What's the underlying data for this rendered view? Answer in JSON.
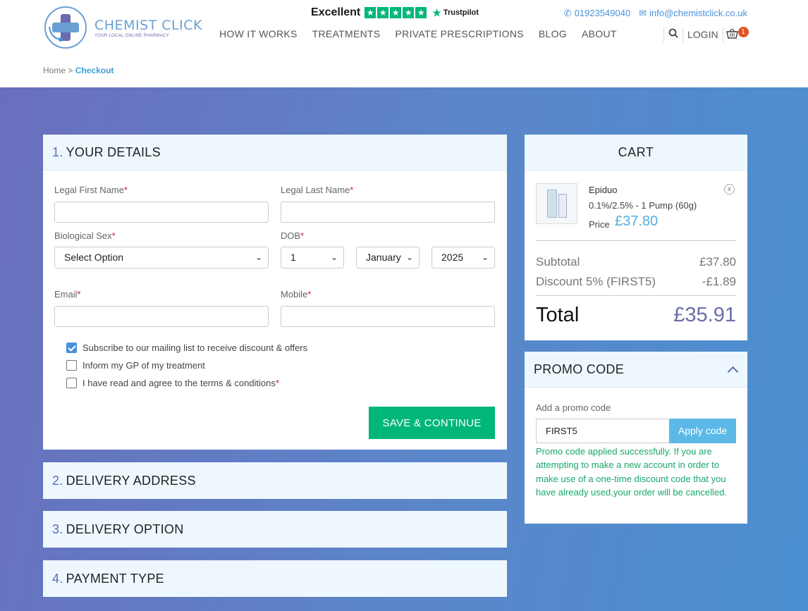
{
  "header": {
    "logo": {
      "name": "CHEMIST CLICK",
      "tagline": "YOUR LOCAL ONLINE PHARMACY"
    },
    "trustpilot": {
      "label": "Excellent",
      "stars": 5,
      "brand": "Trustpilot"
    },
    "contact": {
      "phone": "01923549040",
      "email": "info@chemistclick.co.uk"
    },
    "nav": [
      "HOW IT WORKS",
      "TREATMENTS",
      "PRIVATE PRESCRIPTIONS",
      "BLOG",
      "ABOUT"
    ],
    "login_label": "LOGIN",
    "cart_count": "1"
  },
  "breadcrumb": {
    "home": "Home",
    "sep": ">",
    "current": "Checkout"
  },
  "steps": {
    "details": {
      "num": "1.",
      "title": "YOUR DETAILS",
      "first_name_label": "Legal First Name",
      "last_name_label": "Legal Last Name",
      "sex_label": "Biological Sex",
      "sex_value": "Select Option",
      "dob_label": "DOB",
      "dob_day": "1",
      "dob_month": "January",
      "dob_year": "2025",
      "email_label": "Email",
      "mobile_label": "Mobile",
      "req_mark": "*",
      "check_subscribe": "Subscribe to our mailing list to receive discount & offers",
      "check_gp": "Inform my GP of my treatment",
      "check_terms": "I have read and agree to the terms & conditions",
      "save_label": "SAVE & CONTINUE"
    },
    "delivery_address": {
      "num": "2.",
      "title": "DELIVERY ADDRESS"
    },
    "delivery_option": {
      "num": "3.",
      "title": "DELIVERY OPTION"
    },
    "payment_type": {
      "num": "4.",
      "title": "PAYMENT TYPE"
    }
  },
  "cart": {
    "title": "CART",
    "product_name": "Epiduo",
    "product_variant": "0.1%/2.5% - 1 Pump (60g)",
    "price_label": "Price",
    "price": "£37.80",
    "remove": "x",
    "subtotal_label": "Subtotal",
    "subtotal": "£37.80",
    "discount_label": "Discount 5% (FIRST5)",
    "discount": "-£1.89",
    "total_label": "Total",
    "total": "£35.91"
  },
  "promo": {
    "title": "PROMO CODE",
    "label": "Add a promo code",
    "code": "FIRST5",
    "apply_label": "Apply code",
    "message": "Promo code applied successfully. If you are attempting to make a new account in order to make use of a one-time discount code that you have already used,your order will be cancelled."
  },
  "colors": {
    "accent_green": "#00b67a",
    "accent_blue": "#4fb0e3",
    "step_number": "#5c6bb5"
  }
}
